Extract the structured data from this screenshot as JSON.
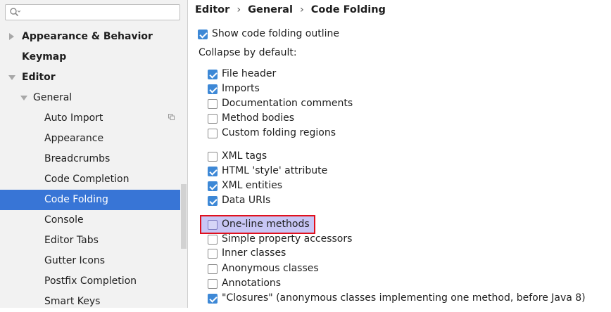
{
  "search": {
    "placeholder": ""
  },
  "sidebar": {
    "items": [
      {
        "label": "Appearance & Behavior"
      },
      {
        "label": "Keymap"
      },
      {
        "label": "Editor"
      },
      {
        "label": "General"
      },
      {
        "label": "Auto Import"
      },
      {
        "label": "Appearance"
      },
      {
        "label": "Breadcrumbs"
      },
      {
        "label": "Code Completion"
      },
      {
        "label": "Code Folding"
      },
      {
        "label": "Console"
      },
      {
        "label": "Editor Tabs"
      },
      {
        "label": "Gutter Icons"
      },
      {
        "label": "Postfix Completion"
      },
      {
        "label": "Smart Keys"
      }
    ],
    "selected": "Code Folding"
  },
  "breadcrumb": {
    "parts": [
      "Editor",
      "General",
      "Code Folding"
    ],
    "separator": "›"
  },
  "main": {
    "show_outline": {
      "label": "Show code folding outline",
      "checked": true
    },
    "collapse_label": "Collapse by default:",
    "group1": [
      {
        "label": "File header",
        "checked": true
      },
      {
        "label": "Imports",
        "checked": true
      },
      {
        "label": "Documentation comments",
        "checked": false
      },
      {
        "label": "Method bodies",
        "checked": false
      },
      {
        "label": "Custom folding regions",
        "checked": false
      }
    ],
    "group2": [
      {
        "label": "XML tags",
        "checked": false
      },
      {
        "label": "HTML 'style' attribute",
        "checked": true
      },
      {
        "label": "XML entities",
        "checked": true
      },
      {
        "label": "Data URIs",
        "checked": true
      }
    ],
    "group3": [
      {
        "label": "One-line methods",
        "checked": false
      },
      {
        "label": "Simple property accessors",
        "checked": false
      },
      {
        "label": "Inner classes",
        "checked": false
      },
      {
        "label": "Anonymous classes",
        "checked": false
      },
      {
        "label": "Annotations",
        "checked": false
      },
      {
        "label": "\"Closures\" (anonymous classes implementing one method, before Java 8)",
        "checked": true
      }
    ]
  },
  "colors": {
    "selection": "#3875d6",
    "checkbox": "#3d88d6",
    "highlight_border": "#e0101e",
    "highlight_fill": "#c8c6f5"
  }
}
